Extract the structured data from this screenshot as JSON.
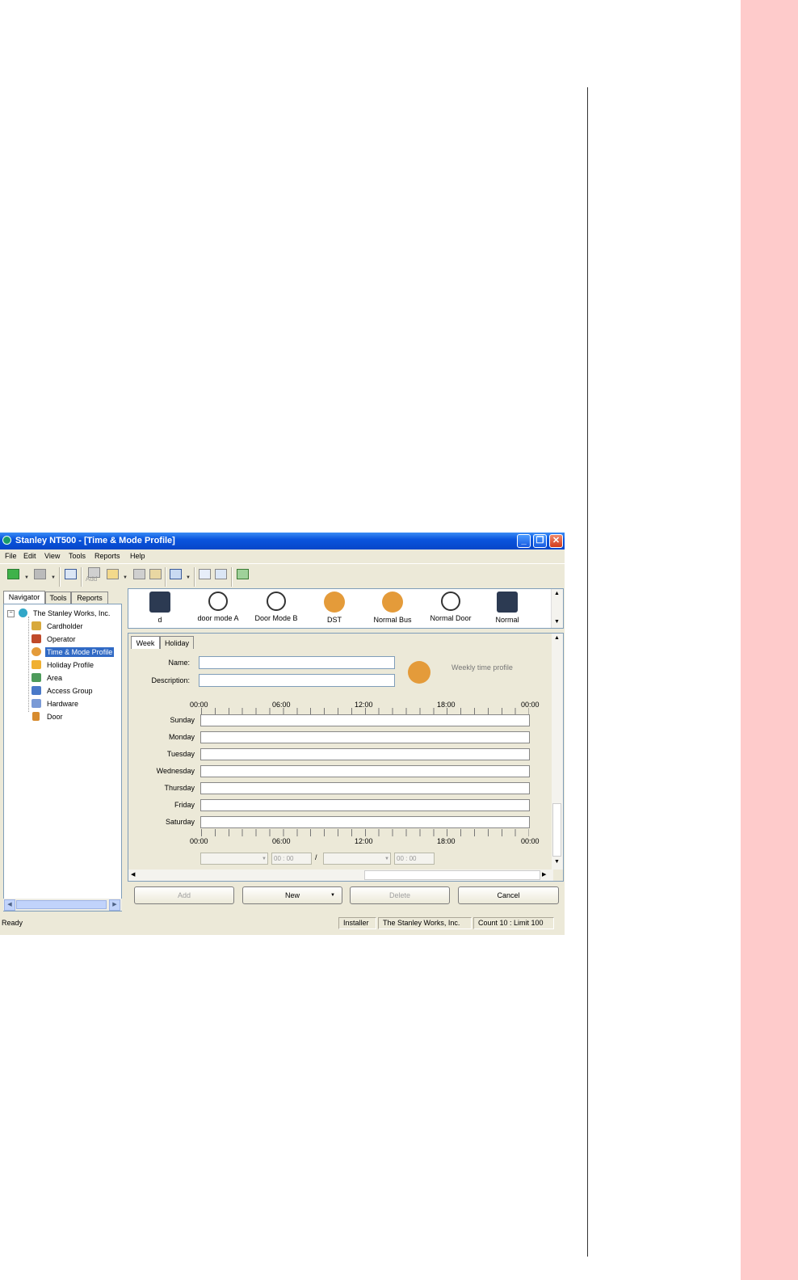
{
  "window": {
    "title": "Stanley NT500 - [Time & Mode Profile]"
  },
  "menu": [
    "File",
    "Edit",
    "View",
    "Tools",
    "Reports",
    "Help"
  ],
  "toolbar": {
    "add_label": "Add"
  },
  "nav": {
    "tabs": [
      "Navigator",
      "Tools",
      "Reports"
    ],
    "root": "The Stanley Works, Inc.",
    "items": [
      "Cardholder",
      "Operator",
      "Time & Mode Profile",
      "Holiday Profile",
      "Area",
      "Access Group",
      "Hardware",
      "Door"
    ],
    "selected": "Time & Mode Profile"
  },
  "profiles": [
    "d",
    "door mode A",
    "Door Mode B",
    "DST",
    "Normal Bus",
    "Normal Door",
    "Normal"
  ],
  "form": {
    "tabs": [
      "Week",
      "Holiday"
    ],
    "name_label": "Name:",
    "description_label": "Description:",
    "profile_type": "Weekly time profile",
    "hours": [
      "00:00",
      "06:00",
      "12:00",
      "18:00",
      "00:00"
    ],
    "days": [
      "Sunday",
      "Monday",
      "Tuesday",
      "Wednesday",
      "Thursday",
      "Friday",
      "Saturday"
    ],
    "time_value": "00 : 00",
    "range_separator": "/"
  },
  "buttons": {
    "add": "Add",
    "new": "New",
    "delete": "Delete",
    "cancel": "Cancel"
  },
  "status": {
    "state": "Ready",
    "user": "Installer",
    "company": "The Stanley Works, Inc.",
    "count": "Count 10 : Limit 100"
  },
  "colors": {
    "titlebar": "#0a55de",
    "selection": "#316ac5",
    "window_bg": "#ece9d8",
    "side_strip": "#fecbcb"
  }
}
